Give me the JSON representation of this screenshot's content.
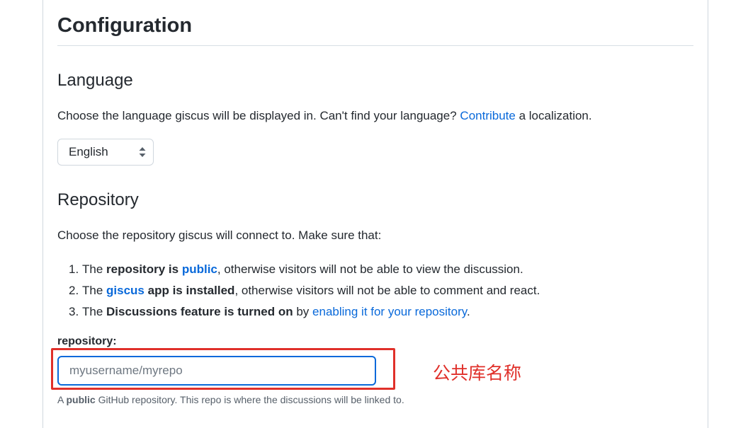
{
  "configuration": {
    "title": "Configuration"
  },
  "language": {
    "heading": "Language",
    "desc_before": "Choose the language giscus will be displayed in. Can't find your language?",
    "desc_link": "Contribute",
    "desc_after": "a localization.",
    "select_value": "English"
  },
  "repository": {
    "heading": "Repository",
    "intro": "Choose the repository giscus will connect to. Make sure that:",
    "items": [
      {
        "num": "1.",
        "pre": "The",
        "bold1": "repository is",
        "link": "public",
        "post": ", otherwise visitors will not be able to view the discussion."
      },
      {
        "num": "2.",
        "pre": "The",
        "link": "giscus",
        "bold1": "app is installed",
        "post": ", otherwise visitors will not be able to comment and react."
      },
      {
        "num": "3.",
        "pre": "The",
        "bold1": "Discussions feature is turned on",
        "mid": "by",
        "link": "enabling it for your repository",
        "post": "."
      }
    ],
    "field_label": "repository:",
    "field_placeholder": "myusername/myrepo",
    "hint_pre": "A",
    "hint_bold": "public",
    "hint_post": "GitHub repository. This repo is where the discussions will be linked to."
  },
  "annotation": {
    "text": "公共库名称",
    "color": "#e0302a"
  },
  "colors": {
    "link": "#0969da",
    "text": "#24292f",
    "muted": "#57606a",
    "focus_border": "#0969da"
  }
}
